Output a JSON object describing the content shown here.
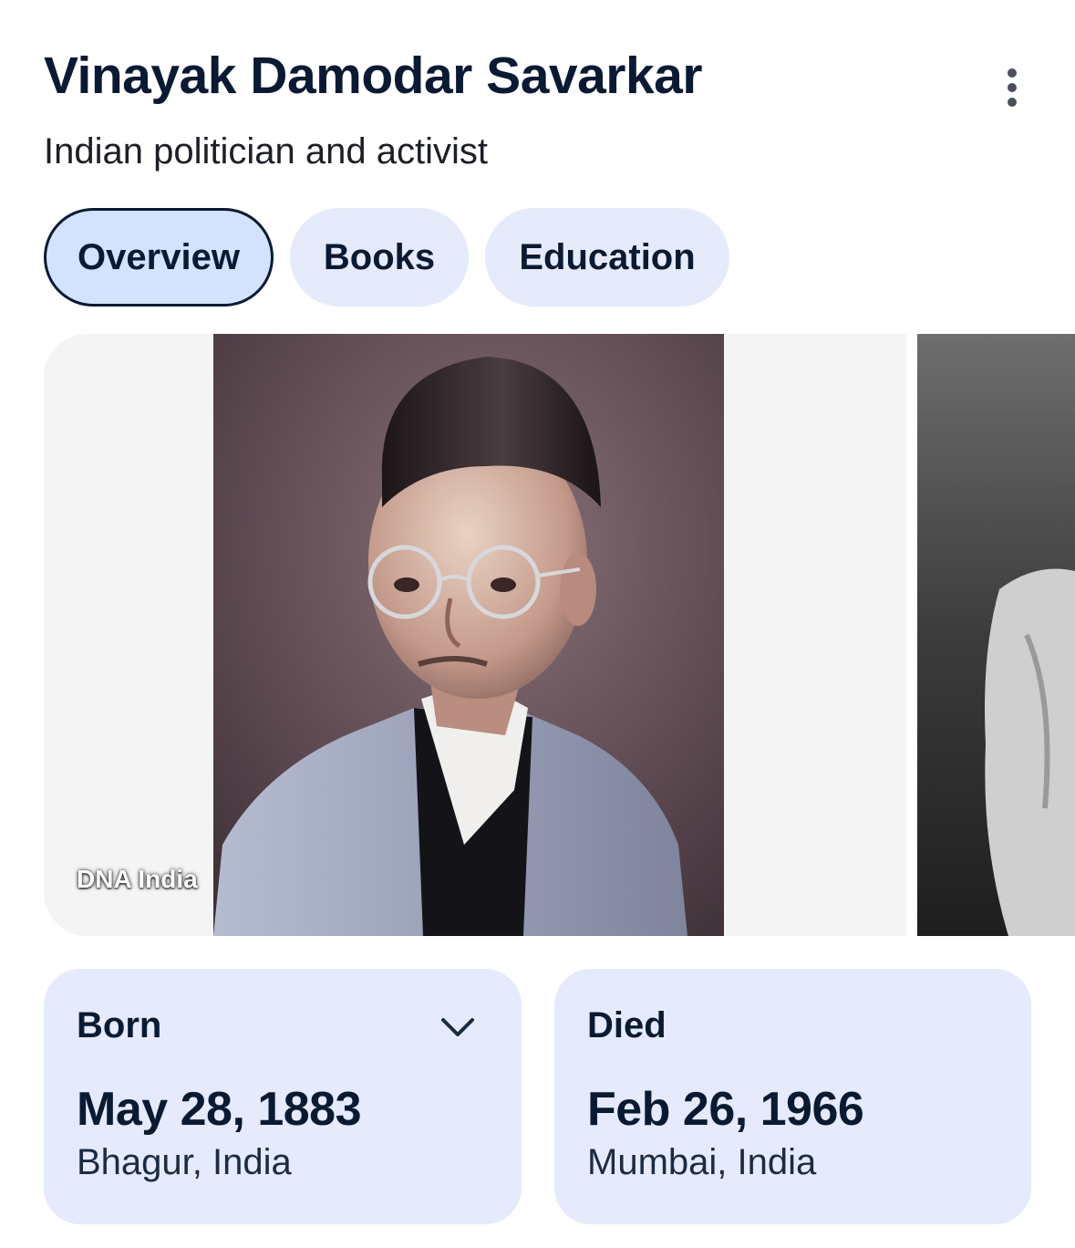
{
  "header": {
    "title": "Vinayak Damodar Savarkar",
    "subtitle": "Indian politician and activist",
    "more_icon": "more-vert-icon"
  },
  "tabs": [
    {
      "label": "Overview",
      "active": true
    },
    {
      "label": "Books",
      "active": false
    },
    {
      "label": "Education",
      "active": false
    }
  ],
  "gallery": {
    "images": [
      {
        "caption": "DNA India"
      },
      {
        "caption": ""
      }
    ]
  },
  "facts": [
    {
      "label": "Born",
      "date": "May 28, 1883",
      "place": "Bhagur, India",
      "expand_icon": "chevron-down-icon"
    },
    {
      "label": "Died",
      "date": "Feb 26, 1966",
      "place": "Mumbai, India"
    }
  ],
  "colors": {
    "title": "#0b1a33",
    "chip_bg": "#e6ebfb",
    "chip_active_bg": "#d3e3fd",
    "card_bg": "#e5ebfc"
  }
}
